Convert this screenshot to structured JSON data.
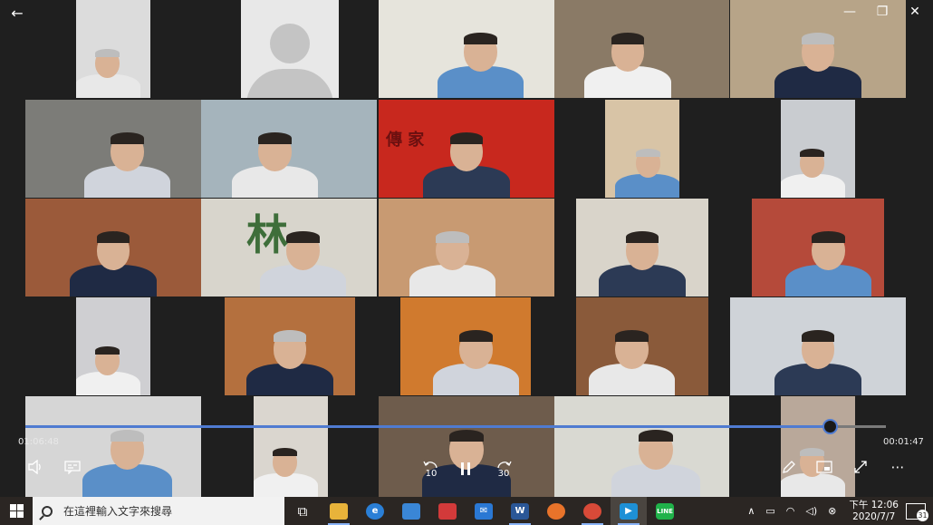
{
  "window": {
    "back_icon": "arrow-left-icon",
    "minimize_icon": "minimize-icon",
    "maximize_icon": "restore-icon",
    "close_icon": "close-icon"
  },
  "video": {
    "tiles": [
      {
        "label": "participant-1",
        "bg": "#dcdcdc",
        "sign": ""
      },
      {
        "label": "participant-2",
        "bg": "#e8e8e8",
        "sign": ""
      },
      {
        "label": "participant-3",
        "bg": "#e6e4dc",
        "sign": ""
      },
      {
        "label": "participant-4",
        "bg": "#8a7a66",
        "sign": ""
      },
      {
        "label": "participant-5",
        "bg": "#b7a488",
        "sign": ""
      },
      {
        "label": "participant-6",
        "bg": "#7c7c78",
        "sign": ""
      },
      {
        "label": "participant-7",
        "bg": "#a5b4bc",
        "sign": ""
      },
      {
        "label": "participant-8",
        "bg": "#c8281e",
        "sign": "傳 家"
      },
      {
        "label": "participant-9",
        "bg": "#d8c4a6",
        "sign": ""
      },
      {
        "label": "participant-10",
        "bg": "#c9ccd0",
        "sign": ""
      },
      {
        "label": "participant-11",
        "bg": "#9b5a3a",
        "sign": ""
      },
      {
        "label": "participant-12",
        "bg": "#d8d5cc",
        "sign": "林"
      },
      {
        "label": "participant-13",
        "bg": "#c89a72",
        "sign": ""
      },
      {
        "label": "participant-14",
        "bg": "#d9d4ca",
        "sign": ""
      },
      {
        "label": "participant-15",
        "bg": "#b54a3a",
        "sign": ""
      },
      {
        "label": "participant-16",
        "bg": "#cfcfd2",
        "sign": ""
      },
      {
        "label": "participant-17",
        "bg": "#b4703e",
        "sign": ""
      },
      {
        "label": "participant-18",
        "bg": "#d07a2e",
        "sign": ""
      },
      {
        "label": "participant-19",
        "bg": "#8a5a3a",
        "sign": ""
      },
      {
        "label": "participant-20",
        "bg": "#cfd3d8",
        "sign": ""
      },
      {
        "label": "participant-21",
        "bg": "#d6d6d6",
        "sign": ""
      },
      {
        "label": "participant-22",
        "bg": "#dad6cf",
        "sign": ""
      },
      {
        "label": "participant-23",
        "bg": "#6e5c4c",
        "sign": ""
      },
      {
        "label": "participant-24",
        "bg": "#d9d9d2",
        "sign": ""
      },
      {
        "label": "participant-25",
        "bg": "#b9a89a",
        "sign": ""
      }
    ]
  },
  "player": {
    "elapsed": "01:06:48",
    "remaining": "00:01:47",
    "progress": 0.935,
    "accent": "#4f7bd1",
    "skip_back_label": "10",
    "skip_forward_label": "30"
  },
  "taskbar": {
    "search_placeholder": "在這裡輸入文字來搜尋",
    "apps": [
      {
        "name": "task-view-icon",
        "color": "#2b2623",
        "glyph": "⧉",
        "active": false
      },
      {
        "name": "file-explorer-icon",
        "color": "#e8b33a",
        "glyph": "",
        "active": false
      },
      {
        "name": "edge-icon",
        "color": "#2a7fd6",
        "glyph": "e",
        "active": false
      },
      {
        "name": "store-icon",
        "color": "#3a86d6",
        "glyph": "",
        "active": false
      },
      {
        "name": "gift-icon",
        "color": "#d23a3a",
        "glyph": "",
        "active": false
      },
      {
        "name": "mail-icon",
        "color": "#2a78d4",
        "glyph": "✉",
        "active": false
      },
      {
        "name": "word-icon",
        "color": "#2b5797",
        "glyph": "W",
        "active": false
      },
      {
        "name": "firefox-icon",
        "color": "#e8732a",
        "glyph": "",
        "active": false
      },
      {
        "name": "chrome-icon",
        "color": "#d84a38",
        "glyph": "",
        "active": false
      },
      {
        "name": "movies-tv-icon",
        "color": "#1e90d6",
        "glyph": "▶",
        "active": true
      },
      {
        "name": "line-icon",
        "color": "#20b24a",
        "glyph": "LINE",
        "active": false
      }
    ],
    "time": "下午 12:06",
    "date": "2020/7/7",
    "notification_count": "31"
  }
}
